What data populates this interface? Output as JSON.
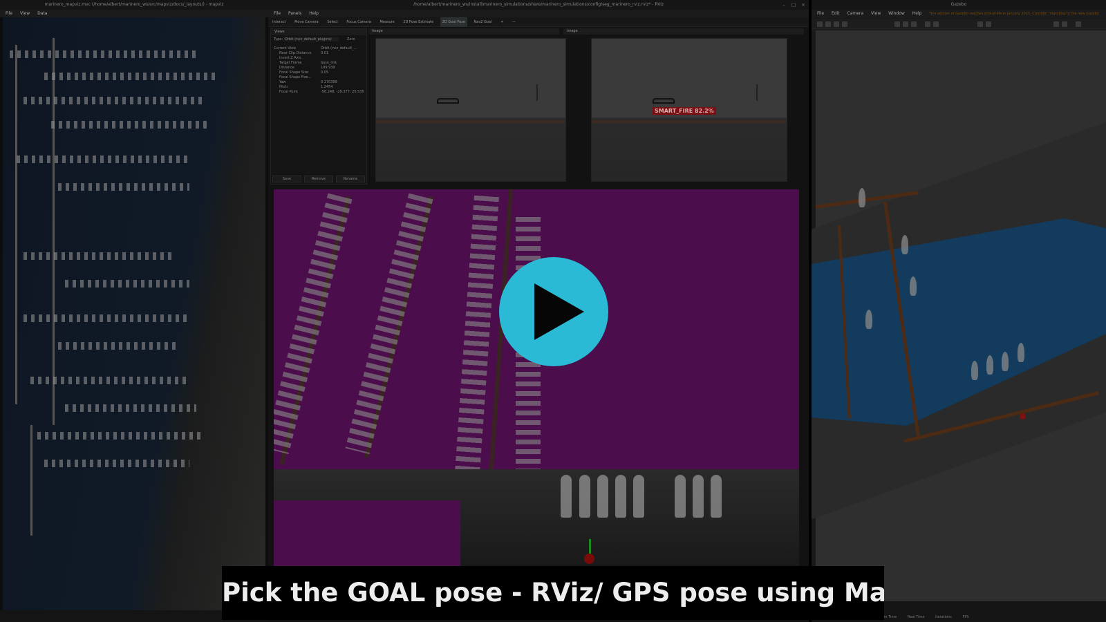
{
  "mapviz": {
    "title": "marinero_mapviz.mvc (/home/albert/marinero_ws/src/mapviz/docs/_layouts/) - mapviz",
    "menu": [
      "File",
      "View",
      "Data"
    ]
  },
  "rviz": {
    "title": "/home/albert/marinero_ws/install/marinero_simulations/share/marinero_simulations/config/seg_marinero_rviz.rviz* - RViz",
    "menu": [
      "File",
      "Panels",
      "Help"
    ],
    "toolbar": [
      "Interact",
      "Move Camera",
      "Select",
      "Focus Camera",
      "Measure",
      "2D Pose Estimate",
      "2D Goal Pose",
      "Nav2 Goal",
      "+",
      "—"
    ],
    "active_tool": "2D Goal Pose",
    "views_panel": {
      "header": "Views",
      "type_label": "Type:",
      "type_value": "Orbit (rviz_default_plugins)",
      "zero_button": "Zero",
      "rows": [
        {
          "label": "Current View",
          "value": "Orbit (rviz_default_..."
        },
        {
          "label": "Near Clip Distance",
          "value": "0.01"
        },
        {
          "label": "Invert Z Axis",
          "value": ""
        },
        {
          "label": "Target Frame",
          "value": "base_link"
        },
        {
          "label": "Distance",
          "value": "199.939"
        },
        {
          "label": "Focal Shape Size",
          "value": "0.05"
        },
        {
          "label": "Focal Shape Fixe...",
          "value": ""
        },
        {
          "label": "Yaw",
          "value": "0.170399"
        },
        {
          "label": "Pitch",
          "value": "1.2454"
        },
        {
          "label": "Focal Point",
          "value": "-56.248; -29.377; 25.535"
        }
      ],
      "buttons": [
        "Save",
        "Remove",
        "Rename"
      ]
    },
    "image_panel_1": {
      "header": "Image"
    },
    "image_panel_2": {
      "header": "Image",
      "detection_label": "SMART_FIRE 82.2%"
    }
  },
  "gazebo": {
    "title": "Gazebo",
    "menu": [
      "File",
      "Edit",
      "Camera",
      "View",
      "Window",
      "Help"
    ],
    "warning": "This version of Gazebo reaches end-of-life in January 2025. Consider migrating to the new Gazebo",
    "status": [
      "Sim Time",
      "Real Time",
      "Iterations",
      "FPS"
    ]
  },
  "video": {
    "play_icon": "play-icon",
    "accent_color": "#2bbad6"
  },
  "caption": "Pick the GOAL pose - RViz/ GPS pose using Mapviz"
}
